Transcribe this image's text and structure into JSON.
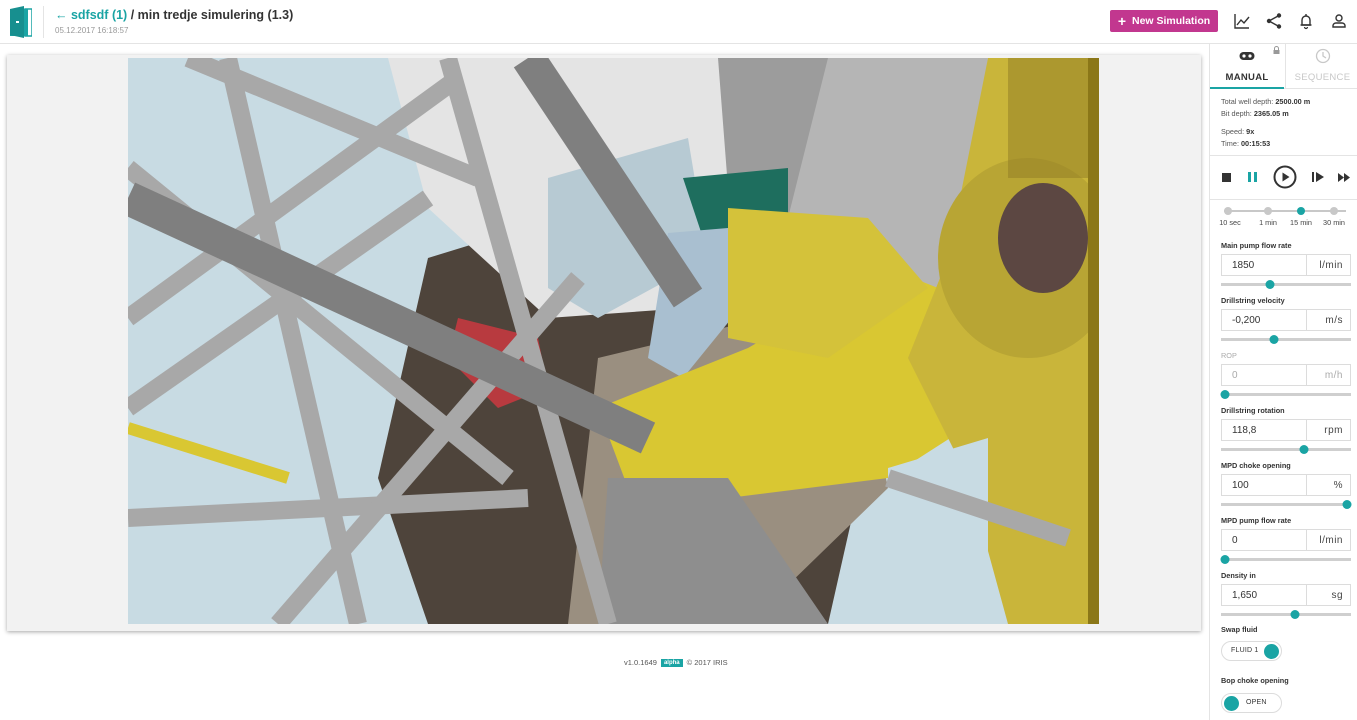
{
  "header": {
    "back_label": "← sdfsdf (1)",
    "separator": " / ",
    "simulation_name": "min tredje simulering  (1.3)",
    "timestamp": "05.12.2017 16:18:57",
    "new_simulation_label": "New Simulation",
    "icons": [
      "chart-icon",
      "share-icon",
      "bell-icon",
      "user-icon"
    ]
  },
  "colors": {
    "accent": "#1aa4a4",
    "primary_button": "#c2378f"
  },
  "viewport": {
    "scene_description": "3D drilling rig visualization"
  },
  "footer": {
    "version": "v1.0.1649",
    "badge": "alpha",
    "copyright": "© 2017 IRIS"
  },
  "panel": {
    "tabs": [
      {
        "label": "MANUAL",
        "icon": "gamepad-icon",
        "active": true,
        "locked": true
      },
      {
        "label": "SEQUENCE",
        "icon": "clock-icon",
        "active": false
      }
    ],
    "info": {
      "total_well_depth_label": "Total well depth: ",
      "total_well_depth": "2500.00 m",
      "bit_depth_label": "Bit depth: ",
      "bit_depth": "2365.05 m",
      "speed_label": "Speed: ",
      "speed": "9x",
      "time_label": "Time: ",
      "time": "00:15:53"
    },
    "playback": {
      "buttons": [
        "stop",
        "pause",
        "play",
        "step-forward",
        "fast-forward"
      ],
      "active": "pause"
    },
    "interval": {
      "options": [
        "10 sec",
        "1 min",
        "15 min",
        "30 min"
      ],
      "selected": "15 min"
    },
    "fields": [
      {
        "label": "Main pump flow rate",
        "value": "1850",
        "unit": "l/min",
        "slider_fraction": 0.37,
        "disabled": false
      },
      {
        "label": "Drillstring velocity",
        "value": "-0,200",
        "unit": "m/s",
        "slider_fraction": 0.4,
        "disabled": false
      },
      {
        "label": "ROP",
        "value": "0",
        "unit": "m/h",
        "slider_fraction": 0.0,
        "disabled": true
      },
      {
        "label": "Drillstring rotation",
        "value": "118,8",
        "unit": "rpm",
        "slider_fraction": 0.65,
        "disabled": false
      },
      {
        "label": "MPD choke opening",
        "value": "100",
        "unit": "%",
        "slider_fraction": 1.0,
        "disabled": false
      },
      {
        "label": "MPD pump flow rate",
        "value": "0",
        "unit": "l/min",
        "slider_fraction": 0.0,
        "disabled": false
      },
      {
        "label": "Density in",
        "value": "1,650",
        "unit": "sg",
        "slider_fraction": 0.57,
        "disabled": false
      }
    ],
    "swap_fluid": {
      "label": "Swap fluid",
      "value": "FLUID 1"
    },
    "bop_choke": {
      "label": "Bop choke opening",
      "value": "OPEN"
    }
  }
}
